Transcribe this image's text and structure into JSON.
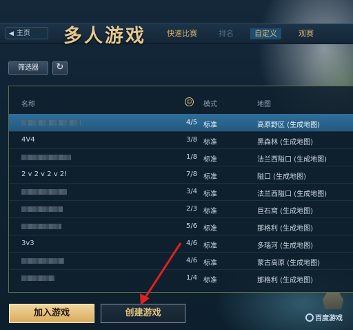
{
  "header": {
    "back_label": "主页",
    "title": "多人游戏",
    "tabs": [
      {
        "label": "快速比赛",
        "state": "normal"
      },
      {
        "label": "排名",
        "state": "disabled"
      },
      {
        "label": "自定义",
        "state": "active"
      },
      {
        "label": "观赛",
        "state": "normal"
      }
    ]
  },
  "toolbar": {
    "filter_label": "筛选器",
    "refresh_icon": "refresh-icon"
  },
  "table": {
    "columns": {
      "name": "名称",
      "players_icon": "players-icon",
      "mode": "模式",
      "map": "地图"
    },
    "selected_index": 0,
    "rows": [
      {
        "name": "",
        "players": "4/5",
        "mode": "标准",
        "map": "高原野区 (生成地图)"
      },
      {
        "name": "4V4",
        "players": "3/8",
        "mode": "标准",
        "map": "黑森林 (生成地图)"
      },
      {
        "name": "",
        "players": "1/8",
        "mode": "标准",
        "map": "法兰西隘口 (生成地图)"
      },
      {
        "name": "2 v 2 v 2 v 2!",
        "players": "7/8",
        "mode": "标准",
        "map": "隘口 (生成地图)"
      },
      {
        "name": "",
        "players": "3/4",
        "mode": "标准",
        "map": "法兰西隘口 (生成地图)"
      },
      {
        "name": "",
        "players": "2/3",
        "mode": "标准",
        "map": "巨石窝 (生成地图)"
      },
      {
        "name": "",
        "players": "5/6",
        "mode": "标准",
        "map": "那格利 (生成地图)"
      },
      {
        "name": "3v3",
        "players": "4/6",
        "mode": "标准",
        "map": "多瑙河 (生成地图)"
      },
      {
        "name": "",
        "players": "4/6",
        "mode": "标准",
        "map": "蒙古高原 (生成地图)"
      },
      {
        "name": "",
        "players": "1/4",
        "mode": "标准",
        "map": "那格利 (生成地图)"
      }
    ]
  },
  "actions": {
    "join_label": "加入游戏",
    "create_label": "创建游戏"
  },
  "watermark": "百度游戏",
  "colors": {
    "accent_gold": "#e4c88f",
    "selected_row": "#2f6f9a",
    "annotation_arrow": "#e02020"
  }
}
